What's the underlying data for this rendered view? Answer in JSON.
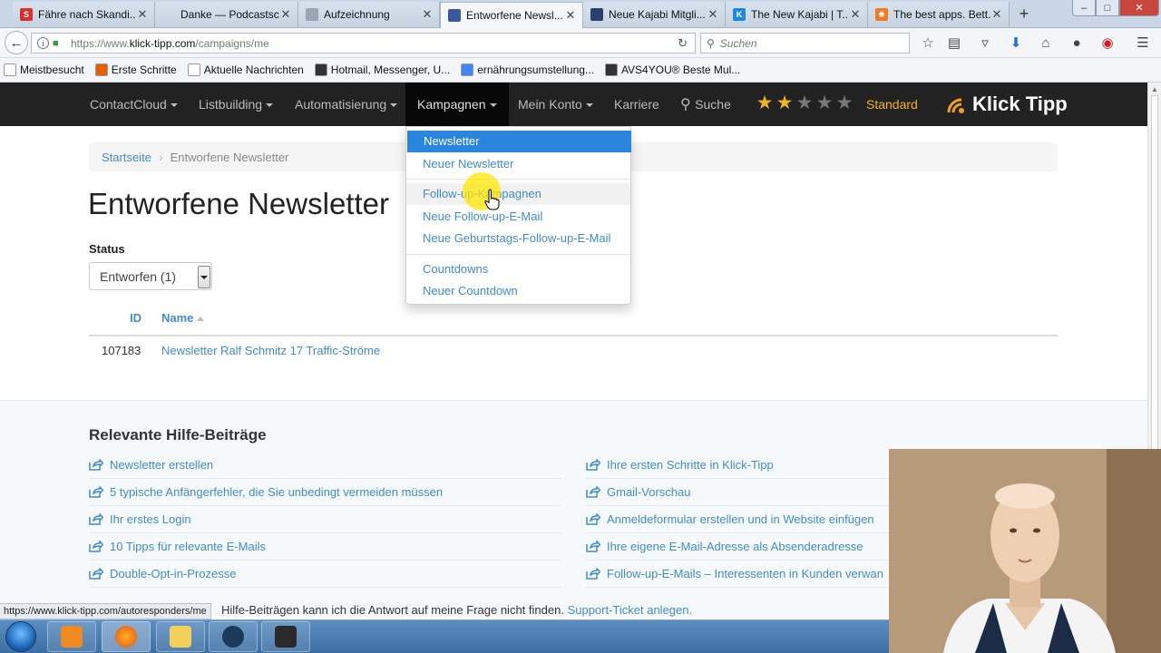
{
  "browser": {
    "tabs": [
      {
        "label": "Fähre nach Skandi...",
        "fav_color": "#d9302c",
        "fav_text": "S"
      },
      {
        "label": "Danke — Podcastschn...",
        "fav_color": "",
        "fav_text": ""
      },
      {
        "label": "Aufzeichnung",
        "fav_color": "#9aa6b4",
        "fav_text": ""
      },
      {
        "label": "Entworfene Newsl...",
        "fav_color": "#3b5998",
        "fav_text": ""
      },
      {
        "label": "Neue Kajabi Mitgli...",
        "fav_color": "#2c3e6b",
        "fav_text": ""
      },
      {
        "label": "The New Kajabi | T...",
        "fav_color": "#1e88e5",
        "fav_text": "K"
      },
      {
        "label": "The best apps. Bett...",
        "fav_color": "#ef7a20",
        "fav_text": "✺"
      }
    ],
    "url_prefix": "https://www.",
    "url_domain": "klick-tipp.com",
    "url_path": "/campaigns/me",
    "search_placeholder": "Suchen",
    "bookmarks": [
      {
        "label": "Meistbesucht",
        "color": "#ffffff"
      },
      {
        "label": "Erste Schritte",
        "color": "#e66000"
      },
      {
        "label": "Aktuelle Nachrichten",
        "color": "#ffffff"
      },
      {
        "label": "Hotmail, Messenger, U...",
        "color": "#333333"
      },
      {
        "label": "ernährungsumstellung...",
        "color": "#4285f4"
      },
      {
        "label": "AVS4YOU® Beste Mul...",
        "color": "#333333"
      }
    ],
    "status_url": "https://www.klick-tipp.com/autoresponders/me"
  },
  "site": {
    "nav": [
      {
        "label": "ContactCloud",
        "caret": true
      },
      {
        "label": "Listbuilding",
        "caret": true
      },
      {
        "label": "Automatisierung",
        "caret": true
      },
      {
        "label": "Kampagnen",
        "caret": true
      },
      {
        "label": "Mein Konto",
        "caret": true
      },
      {
        "label": "Karriere",
        "caret": false
      },
      {
        "label": "Suche",
        "caret": false
      }
    ],
    "rating_stars": 2,
    "rating_max": 5,
    "plan": "Standard",
    "logo_text": "Klick Tipp",
    "accent_color": "#428bca",
    "star_color": "#f0b322"
  },
  "menu": {
    "groups": [
      [
        "Newsletter",
        "Neuer Newsletter"
      ],
      [
        "Follow-up-Kampagnen",
        "Neue Follow-up-E-Mail",
        "Neue Geburtstags-Follow-up-E-Mail"
      ],
      [
        "Countdowns",
        "Neuer Countdown"
      ]
    ]
  },
  "page": {
    "breadcrumb_home": "Startseite",
    "breadcrumb_current": "Entworfene Newsletter",
    "title": "Entworfene Newsletter",
    "status_label": "Status",
    "status_value": "Entworfen (1)",
    "columns": {
      "id": "ID",
      "name": "Name"
    },
    "rows": [
      {
        "id": "107183",
        "name": "Newsletter Ralf Schmitz 17 Traffic-Ströme"
      }
    ]
  },
  "help": {
    "title": "Relevante Hilfe-Beiträge",
    "left_links": [
      "Newsletter erstellen",
      "5 typische Anfängerfehler, die Sie unbedingt vermeiden müssen",
      "Ihr erstes Login",
      "10 Tipps für relevante E-Mails",
      "Double-Opt-in-Prozesse"
    ],
    "right_links": [
      "Ihre ersten Schritte in Klick-Tipp",
      "Gmail-Vorschau",
      "Anmeldeformular erstellen und in Website einfügen",
      "Ihre eigene E-Mail-Adresse als Absenderadresse",
      "Follow-up-E-Mails – Interessenten in Kunden verwan"
    ],
    "footer_text": "Hilfe-Beiträgen kann ich die Antwort auf meine Frage nicht finden.",
    "footer_link": "Support-Ticket anlegen."
  }
}
